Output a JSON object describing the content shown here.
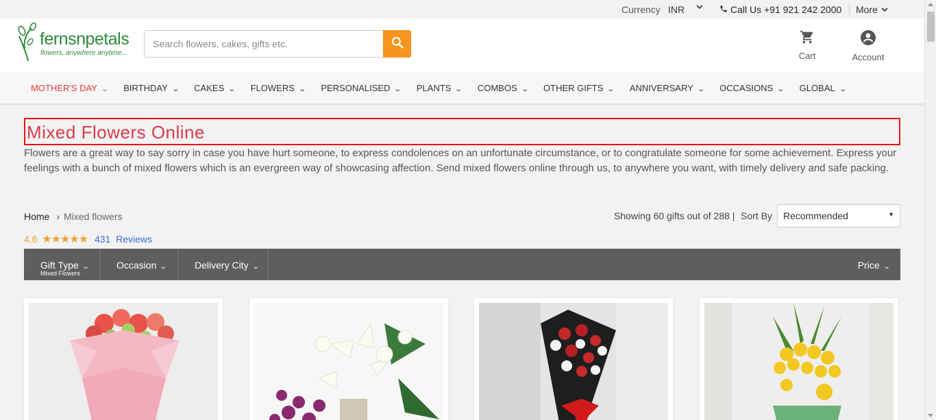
{
  "topbar": {
    "currency_label": "Currency",
    "currency_value": "INR",
    "call_text": "Call Us +91 921 242 2000",
    "more_label": "More"
  },
  "header": {
    "logo_brand": "fernsnpetals",
    "logo_tagline": "flowers, anywhere anytime...",
    "search_placeholder": "Search flowers, cakes, gifts etc.",
    "cart_label": "Cart",
    "account_label": "Account"
  },
  "nav": {
    "items": [
      {
        "label": "MOTHER'S DAY"
      },
      {
        "label": "BIRTHDAY"
      },
      {
        "label": "CAKES"
      },
      {
        "label": "FLOWERS"
      },
      {
        "label": "PERSONALISED"
      },
      {
        "label": "PLANTS"
      },
      {
        "label": "COMBOS"
      },
      {
        "label": "OTHER GIFTS"
      },
      {
        "label": "ANNIVERSARY"
      },
      {
        "label": "OCCASIONS"
      },
      {
        "label": "GLOBAL"
      }
    ]
  },
  "main": {
    "title": "Mixed Flowers Online",
    "description": "Flowers are a great way to say sorry in case you have hurt someone, to express condolences on an unfortunate circumstance, or to congratulate someone for some achievement. Express your feelings with a bunch of mixed flowers which is an evergreen way of showcasing affection. Send mixed flowers online through us, to anywhere you want, with timely delivery and safe packing."
  },
  "breadcrumb": {
    "home": "Home",
    "current": "Mixed flowers"
  },
  "rating": {
    "value": "4.6",
    "stars": "★★★★★",
    "reviews_count": "431",
    "reviews_label": "Reviews"
  },
  "listing": {
    "showing_text": "Showing 60 gifts out of 288 |",
    "sort_label": "Sort By",
    "sort_value": "Recommended"
  },
  "filters": {
    "gift_type": "Gift Type",
    "gift_type_value": "Mixed Flowers",
    "occasion": "Occasion",
    "delivery_city": "Delivery City",
    "price": "Price"
  },
  "colors": {
    "accent_orange": "#f7941d",
    "nav_active": "#e53935",
    "title_red": "#d93b4a",
    "filter_bar": "#5e5e5e",
    "brand_green": "#2e8b3d",
    "star_color": "#f0a030",
    "link_blue": "#3a6fd0"
  },
  "icons": {
    "search": "search-icon",
    "cart": "cart-icon",
    "account": "account-icon",
    "phone": "phone-icon",
    "chevron": "chevron-down-icon"
  }
}
